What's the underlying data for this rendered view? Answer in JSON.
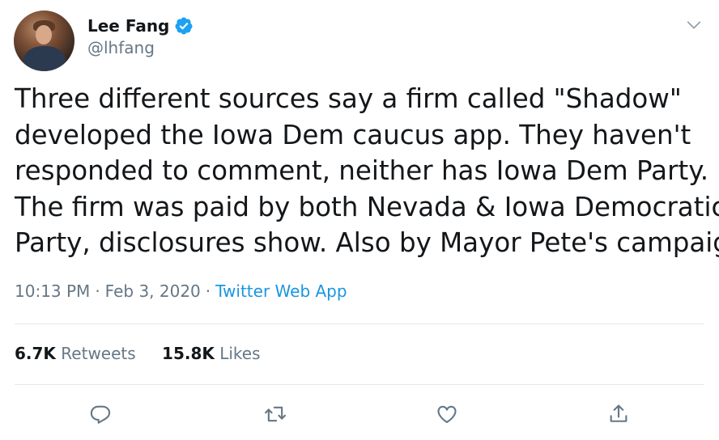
{
  "user": {
    "name": "Lee Fang",
    "handle": "@lhfang",
    "verified": true
  },
  "tweet": {
    "lines": [
      "Three different sources say a firm called \"Shadow\"",
      "developed the Iowa Dem caucus app. They haven't",
      "responded to comment, neither has Iowa Dem Party.",
      "The firm was paid by both Nevada & Iowa Democratic",
      "Party, disclosures show. Also by Mayor Pete's campaign."
    ],
    "time": "10:13 PM",
    "separator": "·",
    "date": "Feb 3, 2020",
    "source": "Twitter Web App"
  },
  "stats": {
    "retweets_count": "6.7K",
    "retweets_label": "Retweets",
    "likes_count": "15.8K",
    "likes_label": "Likes"
  },
  "icons": {
    "more": "chevron-down-icon",
    "reply": "reply-icon",
    "retweet": "retweet-icon",
    "like": "heart-icon",
    "share": "share-icon",
    "verified": "verified-badge-icon"
  },
  "colors": {
    "text": "#14171a",
    "secondary": "#657786",
    "link": "#1b95e0",
    "verified": "#1da1f2",
    "divider": "#e1e8ed"
  }
}
